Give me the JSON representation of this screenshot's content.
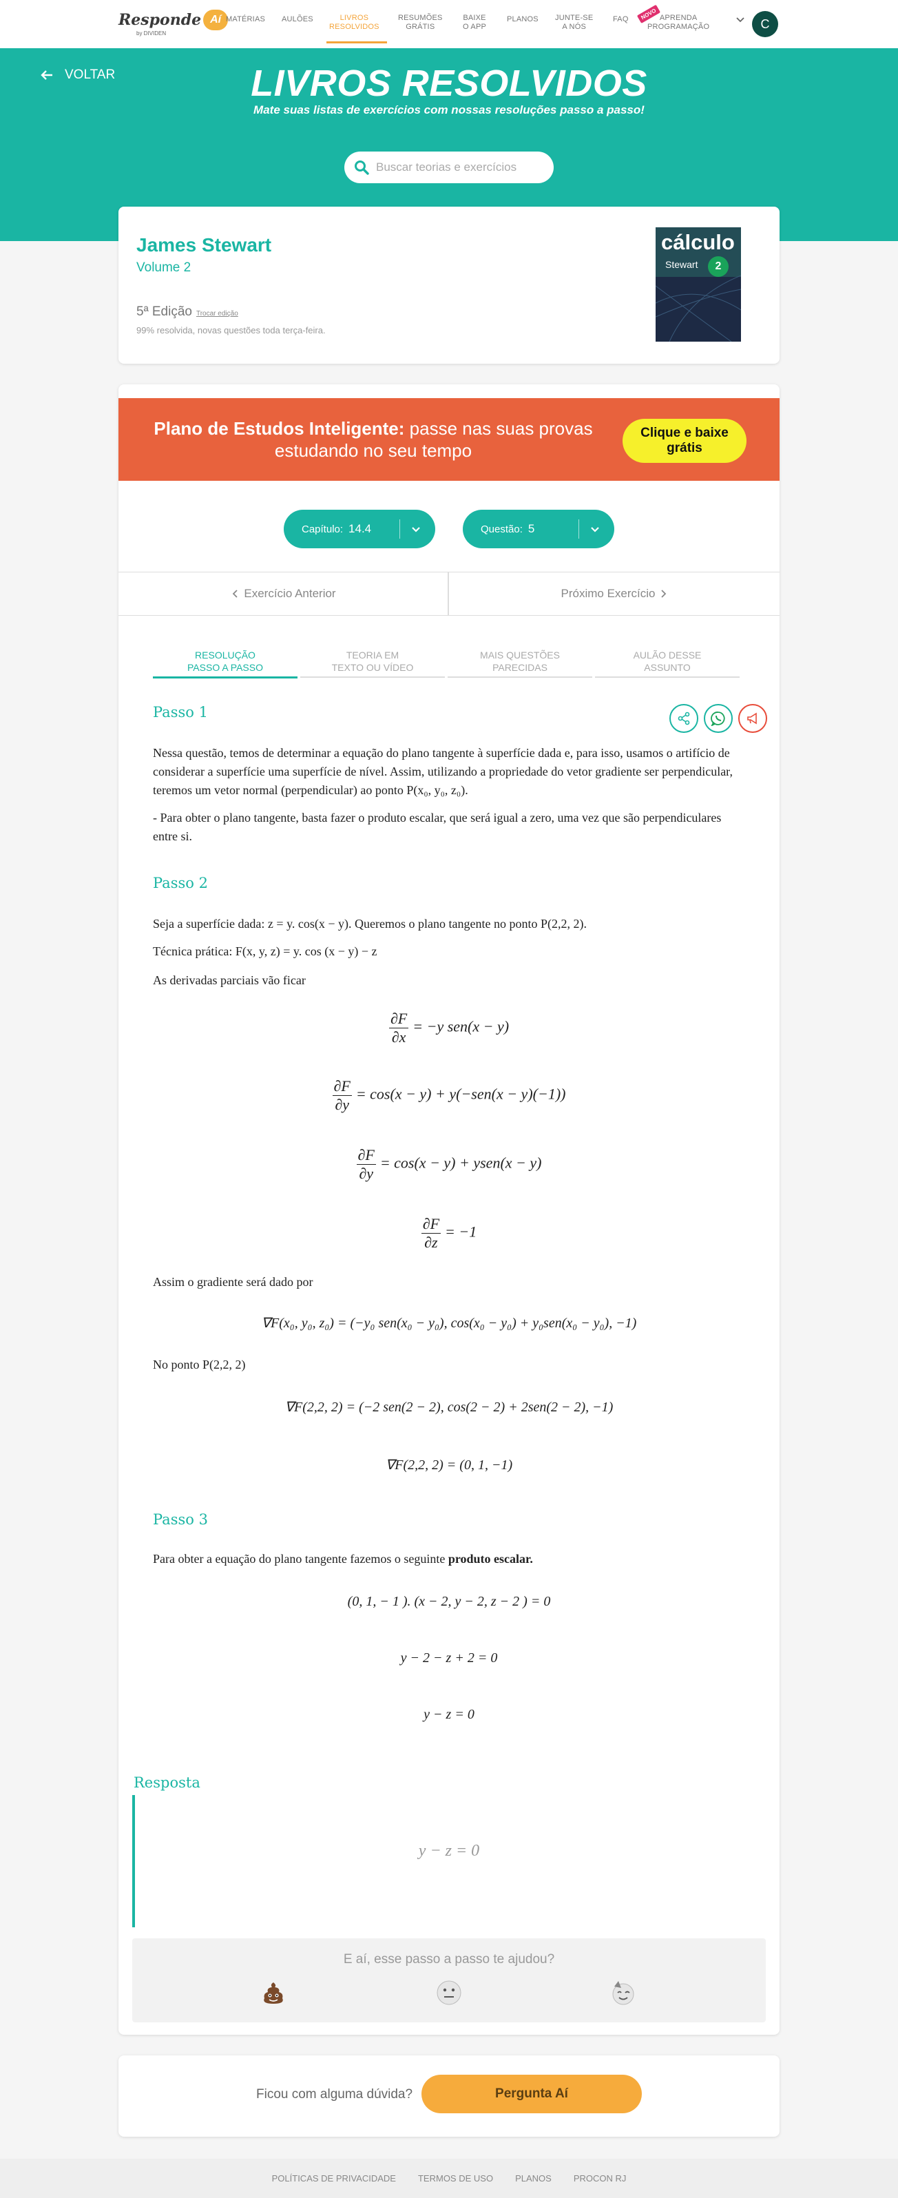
{
  "nav": {
    "logo": "Responde",
    "logo_mark": "Aí",
    "logo_sub": "by DIVIDEN",
    "items": [
      {
        "line1": "Matérias",
        "line2": ""
      },
      {
        "line1": "Aulões",
        "line2": ""
      },
      {
        "line1": "Livros",
        "line2": "Resolvidos"
      },
      {
        "line1": "Resumões",
        "line2": "Grátis"
      },
      {
        "line1": "Baixe",
        "line2": "o App"
      },
      {
        "line1": "Planos",
        "line2": ""
      },
      {
        "line1": "Junte-se",
        "line2": "a nós"
      },
      {
        "line1": "FAQ",
        "line2": ""
      },
      {
        "line1": "Aprenda",
        "line2": "Programação"
      }
    ],
    "new_tag": "NOVO",
    "avatar_initial": "C",
    "accent": "#f4a43a"
  },
  "hero": {
    "back_label": "VOLTAR",
    "title": "LIVROS RESOLVIDOS",
    "subtitle": "Mate suas listas de exercícios com nossas resoluções passo a passo!",
    "search_placeholder": "Buscar teorias e exercícios",
    "bg_color": "#1ab5a3"
  },
  "book": {
    "author": "James Stewart",
    "volume": "Volume 2",
    "edition": "5ª Edição",
    "edition_link": "Trocar edição",
    "resolved": "99% resolvida, novas questões toda terça-feira.",
    "cover_title": "cálculo",
    "cover_author": "Stewart",
    "cover_number": "2"
  },
  "banner": {
    "bold": "Plano de Estudos Inteligente:",
    "text": " passe nas suas provas estudando no seu tempo",
    "button": "Clique e baixe grátis",
    "color": "#e8623d"
  },
  "selectors": {
    "chapter_label": "Capítulo:",
    "chapter_value": "14.4",
    "question_label": "Questão:",
    "question_value": "5"
  },
  "exercise_nav": {
    "prev": "Exercício Anterior",
    "next": "Próximo Exercício"
  },
  "tabs": [
    {
      "line1": "Resolução",
      "line2": "passo a passo"
    },
    {
      "line1": "Teoria em",
      "line2": "texto ou vídeo"
    },
    {
      "line1": "Mais questões",
      "line2": "parecidas"
    },
    {
      "line1": "Aulão desse",
      "line2": "assunto"
    }
  ],
  "steps": {
    "s1_title": "Passo 1",
    "s1_p1": "Nessa questão, temos de determinar a equação do plano tangente à superfície dada e, para isso, usamos o artifício de considerar a superfície uma superfície de nível. Assim, utilizando a propriedade do vetor gradiente ser perpendicular, teremos um vetor normal (perpendicular) ao ponto P(x₀, y₀, z₀).",
    "s1_p2": "- Para obter o plano tangente, basta fazer o produto escalar, que será igual a zero, uma vez que são perpendiculares entre si.",
    "s2_title": "Passo 2",
    "s2_p1": "Seja a superfície dada: z = y. cos(x − y). Queremos o plano tangente no ponto P(2,2, 2).",
    "s2_p2": "Técnica prática: F(x, y, z) = y. cos (x − y) − z",
    "s2_p3": "As derivadas parciais vão ficar",
    "eq1_num": "∂F",
    "eq1_den": "∂x",
    "eq1_rhs": "= −y sen(x − y)",
    "eq2_num": "∂F",
    "eq2_den": "∂y",
    "eq2_rhs": "= cos(x − y) + y(−sen(x − y)(−1))",
    "eq3_num": "∂F",
    "eq3_den": "∂y",
    "eq3_rhs": "= cos(x − y) + ysen(x − y)",
    "eq4_num": "∂F",
    "eq4_den": "∂z",
    "eq4_rhs": "= −1",
    "s2_p4": "Assim o gradiente será dado por",
    "eq5": "∇F(x₀, y₀, z₀) = (−y₀ sen(x₀ − y₀), cos(x₀ − y₀) + y₀sen(x₀ − y₀),  −1)",
    "s2_p5": "No ponto P(2,2, 2)",
    "eq6": "∇F(2,2, 2) = (−2 sen(2 − 2), cos(2 − 2) + 2sen(2 − 2),  −1)",
    "eq7": "∇F(2,2, 2) = (0,  1,  −1)",
    "s3_title": "Passo 3",
    "s3_p1": "Para obter a equação do plano tangente fazemos o seguinte ",
    "s3_p1_bold": "produto escalar.",
    "eq8": "(0,  1,  − 1 ). (x − 2,  y − 2,  z − 2 ) = 0",
    "eq9": "y − 2 − z + 2 = 0",
    "eq10": "y − z = 0"
  },
  "answer": {
    "title": "Resposta",
    "value": "y − z = 0"
  },
  "feedback": {
    "question": "E aí, esse passo a passo te ajudou?"
  },
  "ask": {
    "text": "Ficou com alguma dúvida?",
    "button": "Pergunta Aí"
  },
  "footer": {
    "links": [
      "Políticas de Privacidade",
      "Termos de Uso",
      "Planos",
      "Procon RJ"
    ]
  }
}
